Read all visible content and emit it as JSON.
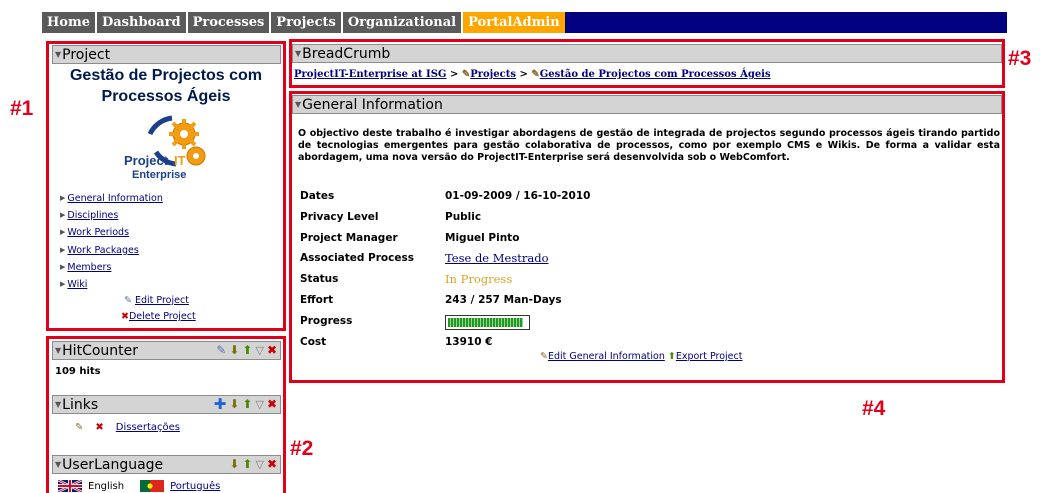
{
  "nav": {
    "tabs": [
      "Home",
      "Dashboard",
      "Processes",
      "Projects",
      "Organizational",
      "PortalAdmin"
    ],
    "active_index": 5
  },
  "markers": {
    "m1": "#1",
    "m2": "#2",
    "m3": "#3",
    "m4": "#4"
  },
  "project_panel": {
    "header": "Project",
    "title": "Gestão de Projectos com Processos Ágeis",
    "logo": {
      "word_project": "Project",
      "word_it": "IT",
      "word_enterprise": "Enterprise"
    },
    "links": [
      "General Information",
      "Disciplines",
      "Work Periods",
      "Work Packages",
      "Members",
      "Wiki"
    ],
    "edit_project": "Edit Project",
    "delete_project": "Delete Project"
  },
  "hitcounter": {
    "header": "HitCounter",
    "value": "109 hits"
  },
  "links_panel": {
    "header": "Links",
    "item": "Dissertações"
  },
  "userlanguage": {
    "header": "UserLanguage",
    "lang1": "English",
    "lang2": "Português"
  },
  "breadcrumb": {
    "header": "BreadCrumb",
    "items": [
      "ProjectIT-Enterprise at ISG",
      "Projects",
      "Gestão de Projectos com Processos Ágeis"
    ],
    "separator": ">"
  },
  "general_info": {
    "header": "General Information",
    "description": "O objectivo deste trabalho é investigar abordagens de gestão de integrada de projectos segundo processos ágeis tirando partido de tecnologias emergentes para gestão colaborativa de processos, como por exemplo CMS e Wikis. De forma a validar esta abordagem, uma nova versão do ProjectIT-Enterprise será desenvolvida sob o WebComfort.",
    "fields": {
      "dates_label": "Dates",
      "dates_value": "01-09-2009 / 16-10-2010",
      "privacy_label": "Privacy Level",
      "privacy_value": "Public",
      "manager_label": "Project Manager",
      "manager_value": "Miguel Pinto",
      "process_label": "Associated Process",
      "process_value": "Tese de Mestrado",
      "status_label": "Status",
      "status_value": "In Progress",
      "effort_label": "Effort",
      "effort_value": "243 / 257 Man-Days",
      "progress_label": "Progress",
      "progress_value": 0.95,
      "cost_label": "Cost",
      "cost_value": "13910 €"
    },
    "edit_link": "Edit General Information",
    "export_link": "Export Project"
  },
  "colors": {
    "nav_bg": "#000080",
    "active_tab": "#ffa500",
    "annotation_red": "#e0001a",
    "status": "#d9a520"
  },
  "icons": [
    "pencil-icon",
    "download-icon",
    "upload-icon",
    "filter-icon",
    "close-icon",
    "plus-icon"
  ]
}
